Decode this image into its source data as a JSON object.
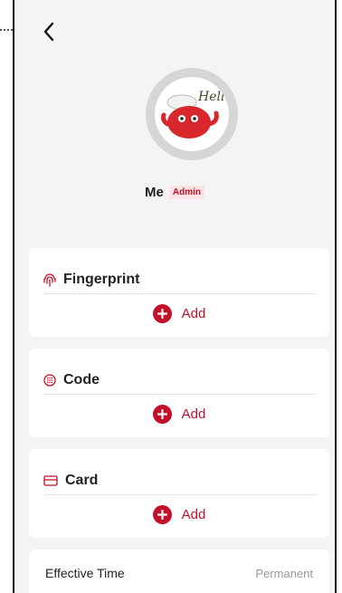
{
  "user": {
    "name": "Me",
    "role_badge": "Admin"
  },
  "avatar": {
    "caption": "Hello"
  },
  "credentials": [
    {
      "title": "Fingerprint",
      "icon": "fingerprint-icon",
      "add_label": "Add"
    },
    {
      "title": "Code",
      "icon": "keypad-icon",
      "add_label": "Add"
    },
    {
      "title": "Card",
      "icon": "card-icon",
      "add_label": "Add"
    }
  ],
  "effective_time": {
    "label": "Effective Time",
    "value": "Permanent"
  },
  "colors": {
    "accent": "#c2102a",
    "background": "#f4f4f4",
    "card": "#ffffff"
  }
}
